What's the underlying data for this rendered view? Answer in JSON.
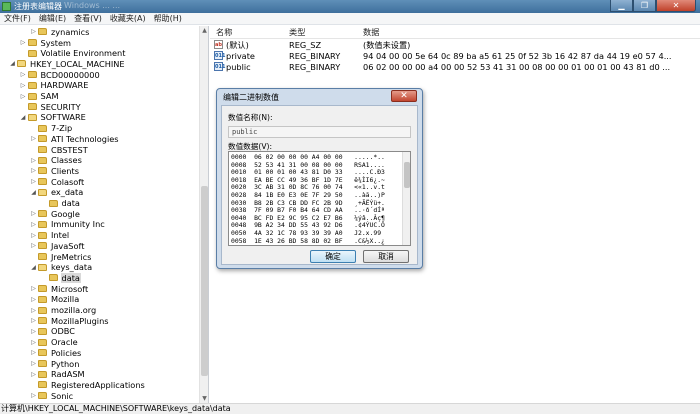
{
  "window": {
    "title": "注册表编辑器",
    "ghost_text": "Windows    ...    ...",
    "buttons": {
      "minimize": "▁",
      "maximize": "❐",
      "close": "✕"
    }
  },
  "menu": [
    "文件(F)",
    "编辑(E)",
    "查看(V)",
    "收藏夹(A)",
    "帮助(H)"
  ],
  "tree": [
    {
      "label": "zynamics",
      "depth": 3,
      "expander": "▷",
      "selected": false
    },
    {
      "label": "System",
      "depth": 2,
      "expander": "▷",
      "selected": false
    },
    {
      "label": "Volatile Environment",
      "depth": 2,
      "expander": "",
      "selected": false
    },
    {
      "label": "HKEY_LOCAL_MACHINE",
      "depth": 1,
      "expander": "◢",
      "selected": false
    },
    {
      "label": "BCD00000000",
      "depth": 2,
      "expander": "▷",
      "selected": false
    },
    {
      "label": "HARDWARE",
      "depth": 2,
      "expander": "▷",
      "selected": false
    },
    {
      "label": "SAM",
      "depth": 2,
      "expander": "▷",
      "selected": false
    },
    {
      "label": "SECURITY",
      "depth": 2,
      "expander": "",
      "selected": false
    },
    {
      "label": "SOFTWARE",
      "depth": 2,
      "expander": "◢",
      "selected": false
    },
    {
      "label": "7-Zip",
      "depth": 3,
      "expander": "",
      "selected": false
    },
    {
      "label": "ATI Technologies",
      "depth": 3,
      "expander": "▷",
      "selected": false
    },
    {
      "label": "CBSTEST",
      "depth": 3,
      "expander": "",
      "selected": false
    },
    {
      "label": "Classes",
      "depth": 3,
      "expander": "▷",
      "selected": false
    },
    {
      "label": "Clients",
      "depth": 3,
      "expander": "▷",
      "selected": false
    },
    {
      "label": "Colasoft",
      "depth": 3,
      "expander": "▷",
      "selected": false
    },
    {
      "label": "ex_data",
      "depth": 3,
      "expander": "◢",
      "selected": false
    },
    {
      "label": "data",
      "depth": 4,
      "expander": "",
      "selected": false
    },
    {
      "label": "Google",
      "depth": 3,
      "expander": "▷",
      "selected": false
    },
    {
      "label": "Immunity Inc",
      "depth": 3,
      "expander": "▷",
      "selected": false
    },
    {
      "label": "Intel",
      "depth": 3,
      "expander": "▷",
      "selected": false
    },
    {
      "label": "JavaSoft",
      "depth": 3,
      "expander": "▷",
      "selected": false
    },
    {
      "label": "JreMetrics",
      "depth": 3,
      "expander": "",
      "selected": false
    },
    {
      "label": "keys_data",
      "depth": 3,
      "expander": "◢",
      "selected": false
    },
    {
      "label": "data",
      "depth": 4,
      "expander": "",
      "selected": true
    },
    {
      "label": "Microsoft",
      "depth": 3,
      "expander": "▷",
      "selected": false
    },
    {
      "label": "Mozilla",
      "depth": 3,
      "expander": "▷",
      "selected": false
    },
    {
      "label": "mozilla.org",
      "depth": 3,
      "expander": "▷",
      "selected": false
    },
    {
      "label": "MozillaPlugins",
      "depth": 3,
      "expander": "▷",
      "selected": false
    },
    {
      "label": "ODBC",
      "depth": 3,
      "expander": "▷",
      "selected": false
    },
    {
      "label": "Oracle",
      "depth": 3,
      "expander": "▷",
      "selected": false
    },
    {
      "label": "Policies",
      "depth": 3,
      "expander": "▷",
      "selected": false
    },
    {
      "label": "Python",
      "depth": 3,
      "expander": "▷",
      "selected": false
    },
    {
      "label": "RadASM",
      "depth": 3,
      "expander": "▷",
      "selected": false
    },
    {
      "label": "RegisteredApplications",
      "depth": 3,
      "expander": "",
      "selected": false
    },
    {
      "label": "Sonic",
      "depth": 3,
      "expander": "▷",
      "selected": false
    }
  ],
  "values_pane": {
    "headers": {
      "name": "名称",
      "type": "类型",
      "data": "数据"
    },
    "rows": [
      {
        "name": "(默认)",
        "type": "REG_SZ",
        "data": "(数值未设置)",
        "icon": "ab"
      },
      {
        "name": "private",
        "type": "REG_BINARY",
        "data": "94 04 00 00 5e 64 0c 89 ba a5 61 25 0f 52 3b 16 42 87 da 44 19 e0 57 4...",
        "icon": "bin"
      },
      {
        "name": "public",
        "type": "REG_BINARY",
        "data": "06 02 00 00 00 a4 00 00 52 53 41 31 00 08 00 00 01 00 01 00 43 81 d0 ...",
        "icon": "bin"
      }
    ]
  },
  "dialog": {
    "title": "编辑二进制数值",
    "close": "✕",
    "name_label": "数值名称(N):",
    "name_value": "public",
    "data_label": "数值数据(V):",
    "hex_lines": [
      "0000  06 02 00 00 00 A4 00 00   .....*..",
      "0008  52 53 41 31 00 08 00 00   RSA1....",
      "0010  01 00 01 00 43 81 D0 33   ....C.Ð3",
      "0018  EA BE CC 49 36 BF 1D 7E   ê¾ÌI6¿.~",
      "0020  3C AB 31 0D 8C 76 00 74   <«1..v.t",
      "0028  84 1B E0 E3 0E 7F 29 50   ..àã..)P",
      "0030  B8 2B C3 CB DD FC 2B 9D   ¸+ÃËÝü+.",
      "0038  7F 09 B7 F0 B4 64 CD AA   ..·ð´dÍª",
      "0040  BC FD E2 9C 95 C2 E7 B6   ¼ýâ..Âç¶",
      "0048  9B A2 34 DD 55 43 92 D6   .¢4ÝUC.Ö",
      "0050  4A 32 1C 78 93 39 39 A0   J2.x.99 ",
      "0058  1E 43 26 BD 58 8D 02 BF   .C&½X..¿",
      "0060  3D 9F B4 7D 2C AF 10 FE   =.´},¯.þ"
    ],
    "ok": "确定",
    "cancel": "取消"
  },
  "status_bar": "计算机\\HKEY_LOCAL_MACHINE\\SOFTWARE\\keys_data\\data"
}
